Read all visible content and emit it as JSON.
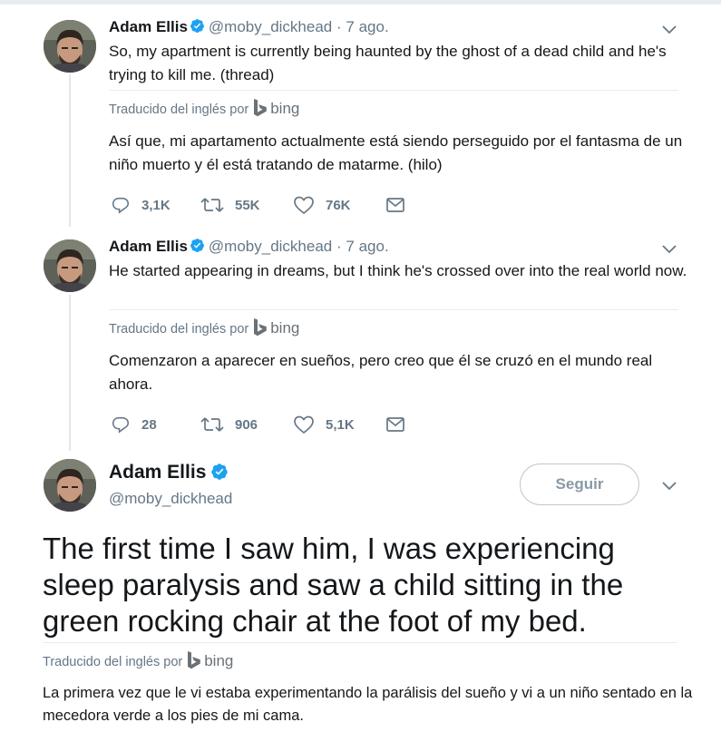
{
  "tweets": [
    {
      "name": "Adam Ellis",
      "handle": "@moby_dickhead",
      "dot": "·",
      "time": "7 ago.",
      "text": "So, my apartment is currently being haunted by the ghost of a dead child and he's trying to kill me. (thread)",
      "translated_by": "Traducido del inglés por",
      "bing": "bing",
      "translation": "Así que, mi apartamento actualmente está siendo perseguido por el fantasma de un niño muerto y él está tratando de matarme. (hilo)",
      "replies": "3,1K",
      "retweets": "55K",
      "likes": "76K"
    },
    {
      "name": "Adam Ellis",
      "handle": "@moby_dickhead",
      "dot": "·",
      "time": "7 ago.",
      "text": "He started appearing in dreams, but I think he's crossed over into the real world now.",
      "translated_by": "Traducido del inglés por",
      "bing": "bing",
      "translation": "Comenzaron a aparecer en sueños, pero creo que él se cruzó en el mundo real ahora.",
      "replies": "28",
      "retweets": "906",
      "likes": "5,1K"
    }
  ],
  "main_tweet": {
    "name": "Adam Ellis",
    "handle": "@moby_dickhead",
    "follow_label": "Seguir",
    "text": "The first time I saw him, I was experiencing sleep paralysis and saw a child sitting in the green rocking chair at the foot of my bed.",
    "translated_by": "Traducido del inglés por",
    "bing": "bing",
    "translation": "La primera vez que le vi estaba experimentando la parálisis del sueño y vi a un niño sentado en la mecedora verde a los pies de mi cama."
  },
  "colors": {
    "verified": "#1da1f2",
    "secondary_text": "#657786",
    "divider": "#e6ecf0"
  },
  "icons": [
    "reply-icon",
    "retweet-icon",
    "like-icon",
    "dm-icon",
    "verified-icon",
    "chevron-down-icon",
    "bing-logo-icon"
  ]
}
